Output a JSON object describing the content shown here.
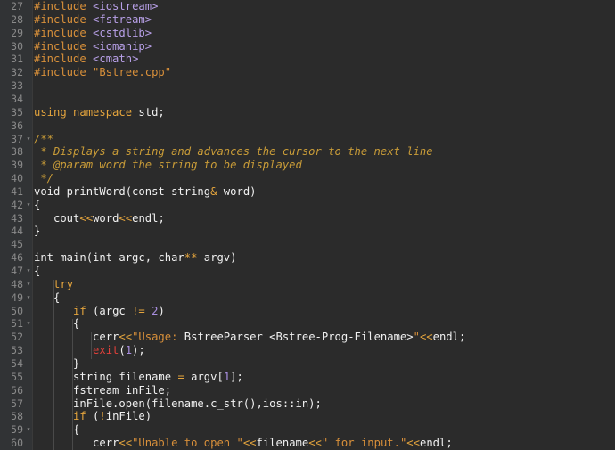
{
  "editor": {
    "lines": [
      {
        "n": "27",
        "fold": "",
        "tokens": [
          {
            "c": "pre",
            "t": "#include "
          },
          {
            "c": "inc",
            "t": "<iostream>"
          }
        ]
      },
      {
        "n": "28",
        "fold": "",
        "tokens": [
          {
            "c": "pre",
            "t": "#include "
          },
          {
            "c": "inc",
            "t": "<fstream>"
          }
        ]
      },
      {
        "n": "29",
        "fold": "",
        "tokens": [
          {
            "c": "pre",
            "t": "#include "
          },
          {
            "c": "inc",
            "t": "<cstdlib>"
          }
        ]
      },
      {
        "n": "30",
        "fold": "",
        "tokens": [
          {
            "c": "pre",
            "t": "#include "
          },
          {
            "c": "inc",
            "t": "<iomanip>"
          }
        ]
      },
      {
        "n": "31",
        "fold": "",
        "tokens": [
          {
            "c": "pre",
            "t": "#include "
          },
          {
            "c": "inc",
            "t": "<cmath>"
          }
        ]
      },
      {
        "n": "32",
        "fold": "",
        "tokens": [
          {
            "c": "pre",
            "t": "#include "
          },
          {
            "c": "str",
            "t": "\"Bstree.cpp\""
          }
        ]
      },
      {
        "n": "33",
        "fold": "",
        "tokens": []
      },
      {
        "n": "34",
        "fold": "",
        "tokens": []
      },
      {
        "n": "35",
        "fold": "",
        "tokens": [
          {
            "c": "kw",
            "t": "using namespace "
          },
          {
            "c": "plain",
            "t": "std;"
          }
        ]
      },
      {
        "n": "36",
        "fold": "",
        "tokens": []
      },
      {
        "n": "37",
        "fold": "▾",
        "tokens": [
          {
            "c": "cm",
            "t": "/**"
          }
        ]
      },
      {
        "n": "38",
        "fold": "",
        "tokens": [
          {
            "c": "cm",
            "t": " * Displays a string and advances the cursor to the next line"
          }
        ]
      },
      {
        "n": "39",
        "fold": "",
        "tokens": [
          {
            "c": "cm",
            "t": " * @param word the string to be displayed"
          }
        ]
      },
      {
        "n": "40",
        "fold": "",
        "tokens": [
          {
            "c": "cm",
            "t": " */"
          }
        ]
      },
      {
        "n": "41",
        "fold": "",
        "tokens": [
          {
            "c": "plain",
            "t": "void printWord(const string"
          },
          {
            "c": "op",
            "t": "&"
          },
          {
            "c": "plain",
            "t": " word)"
          }
        ]
      },
      {
        "n": "42",
        "fold": "▾",
        "tokens": [
          {
            "c": "plain",
            "t": "{"
          }
        ]
      },
      {
        "n": "43",
        "fold": "",
        "tokens": [
          {
            "c": "plain",
            "t": "   cout"
          },
          {
            "c": "op",
            "t": "<<"
          },
          {
            "c": "plain",
            "t": "word"
          },
          {
            "c": "op",
            "t": "<<"
          },
          {
            "c": "plain",
            "t": "endl;"
          }
        ]
      },
      {
        "n": "44",
        "fold": "",
        "tokens": [
          {
            "c": "plain",
            "t": "}"
          }
        ]
      },
      {
        "n": "45",
        "fold": "",
        "tokens": []
      },
      {
        "n": "46",
        "fold": "",
        "tokens": [
          {
            "c": "plain",
            "t": "int main(int argc, char"
          },
          {
            "c": "op",
            "t": "**"
          },
          {
            "c": "plain",
            "t": " argv)"
          }
        ]
      },
      {
        "n": "47",
        "fold": "▾",
        "tokens": [
          {
            "c": "plain",
            "t": "{"
          }
        ]
      },
      {
        "n": "48",
        "fold": "▾",
        "tokens": [
          {
            "c": "plain",
            "t": "   "
          },
          {
            "c": "kw",
            "t": "try"
          }
        ]
      },
      {
        "n": "49",
        "fold": "▾",
        "tokens": [
          {
            "c": "plain",
            "t": "   {"
          }
        ]
      },
      {
        "n": "50",
        "fold": "",
        "tokens": [
          {
            "c": "plain",
            "t": "      "
          },
          {
            "c": "kw",
            "t": "if"
          },
          {
            "c": "plain",
            "t": " (argc "
          },
          {
            "c": "op",
            "t": "!="
          },
          {
            "c": "plain",
            "t": " "
          },
          {
            "c": "num",
            "t": "2"
          },
          {
            "c": "plain",
            "t": ")"
          }
        ]
      },
      {
        "n": "51",
        "fold": "▾",
        "tokens": [
          {
            "c": "plain",
            "t": "      {"
          }
        ]
      },
      {
        "n": "52",
        "fold": "",
        "tokens": [
          {
            "c": "plain",
            "t": "         cerr"
          },
          {
            "c": "op",
            "t": "<<"
          },
          {
            "c": "str",
            "t": "\"Usage: "
          },
          {
            "c": "plain",
            "t": "BstreeParser <Bstree-Prog-Filename>"
          },
          {
            "c": "str",
            "t": "\""
          },
          {
            "c": "op",
            "t": "<<"
          },
          {
            "c": "plain",
            "t": "endl;"
          }
        ]
      },
      {
        "n": "53",
        "fold": "",
        "tokens": [
          {
            "c": "plain",
            "t": "         "
          },
          {
            "c": "red",
            "t": "exit"
          },
          {
            "c": "plain",
            "t": "("
          },
          {
            "c": "num",
            "t": "1"
          },
          {
            "c": "plain",
            "t": ");"
          }
        ]
      },
      {
        "n": "54",
        "fold": "",
        "tokens": [
          {
            "c": "plain",
            "t": "      }"
          }
        ]
      },
      {
        "n": "55",
        "fold": "",
        "tokens": [
          {
            "c": "plain",
            "t": "      string filename "
          },
          {
            "c": "op",
            "t": "="
          },
          {
            "c": "plain",
            "t": " argv["
          },
          {
            "c": "num",
            "t": "1"
          },
          {
            "c": "plain",
            "t": "];"
          }
        ]
      },
      {
        "n": "56",
        "fold": "",
        "tokens": [
          {
            "c": "plain",
            "t": "      fstream inFile;"
          }
        ]
      },
      {
        "n": "57",
        "fold": "",
        "tokens": [
          {
            "c": "plain",
            "t": "      inFile.open(filename.c_str(),ios::in);"
          }
        ]
      },
      {
        "n": "58",
        "fold": "",
        "tokens": [
          {
            "c": "plain",
            "t": "      "
          },
          {
            "c": "kw",
            "t": "if"
          },
          {
            "c": "plain",
            "t": " ("
          },
          {
            "c": "op",
            "t": "!"
          },
          {
            "c": "plain",
            "t": "inFile)"
          }
        ]
      },
      {
        "n": "59",
        "fold": "▾",
        "tokens": [
          {
            "c": "plain",
            "t": "      {"
          }
        ]
      },
      {
        "n": "60",
        "fold": "",
        "tokens": [
          {
            "c": "plain",
            "t": "         cerr"
          },
          {
            "c": "op",
            "t": "<<"
          },
          {
            "c": "str",
            "t": "\"Unable to open \""
          },
          {
            "c": "op",
            "t": "<<"
          },
          {
            "c": "plain",
            "t": "filename"
          },
          {
            "c": "op",
            "t": "<<"
          },
          {
            "c": "str",
            "t": "\" for input.\""
          },
          {
            "c": "op",
            "t": "<<"
          },
          {
            "c": "plain",
            "t": "endl;"
          }
        ]
      }
    ]
  }
}
